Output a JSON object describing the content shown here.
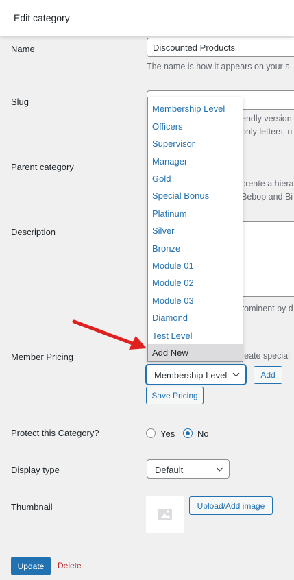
{
  "header": {
    "title": "Edit category"
  },
  "fields": {
    "name": {
      "label": "Name",
      "value": "Discounted Products",
      "description": "The name is how it appears on your s"
    },
    "slug": {
      "label": "Slug",
      "description_line1": "endly version",
      "description_line2": "only letters, n"
    },
    "parent": {
      "label": "Parent category",
      "description_line1": "create a hiera",
      "description_line2": "Bebop and Bi"
    },
    "description": {
      "label": "Description",
      "description_line": "rominent by d"
    },
    "member_pricing": {
      "label": "Member Pricing",
      "description": "reate special",
      "selected_level": "Membership Level",
      "add_label": "Add",
      "save_label": "Save Pricing"
    },
    "protect": {
      "label": "Protect this Category?",
      "yes_label": "Yes",
      "no_label": "No",
      "selected": "No"
    },
    "display_type": {
      "label": "Display type",
      "value": "Default"
    },
    "thumbnail": {
      "label": "Thumbnail",
      "upload_label": "Upload/Add image"
    }
  },
  "dropdown": {
    "options": [
      "Membership Level",
      "Officers",
      "Supervisor",
      "Manager",
      "Gold",
      "Special Bonus",
      "Platinum",
      "Silver",
      "Bronze",
      "Module 01",
      "Module 02",
      "Module 03",
      "Diamond",
      "Test Level",
      "Add New"
    ],
    "highlighted": "Add New"
  },
  "actions": {
    "update_label": "Update",
    "delete_label": "Delete"
  },
  "colors": {
    "accent": "#2271b1",
    "delete": "#b32d2e",
    "arrow": "#e0201e"
  }
}
